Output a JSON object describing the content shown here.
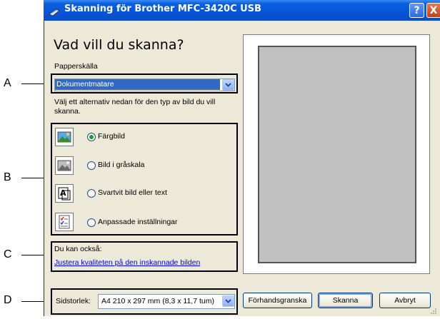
{
  "window": {
    "title": "Skanning för Brother MFC-3420C USB",
    "help_label": "?",
    "close_label": "X"
  },
  "heading": "Vad vill du skanna?",
  "paper_source": {
    "label": "Papperskälla",
    "value": "Dokumentmatare"
  },
  "instructions": "Välj ett alternativ nedan för den typ av bild du vill skanna.",
  "scan_types": [
    {
      "label": "Färgbild",
      "selected": true,
      "icon": "color-photo-icon"
    },
    {
      "label": "Bild i gråskala",
      "selected": false,
      "icon": "grayscale-photo-icon"
    },
    {
      "label": "Svartvit bild eller text",
      "selected": false,
      "icon": "bw-text-icon"
    },
    {
      "label": "Anpassade inställningar",
      "selected": false,
      "icon": "custom-settings-icon"
    }
  ],
  "also": {
    "label": "Du kan också:",
    "link": "Justera kvaliteten på den inskannade bilden"
  },
  "page_size": {
    "label": "Sidstorlek:",
    "value": "A4 210 x 297 mm (8,3 x 11,7 tum)"
  },
  "buttons": {
    "preview": "Förhandsgranska",
    "scan": "Skanna",
    "cancel": "Avbryt"
  },
  "callouts": [
    "A",
    "B",
    "C",
    "D"
  ]
}
